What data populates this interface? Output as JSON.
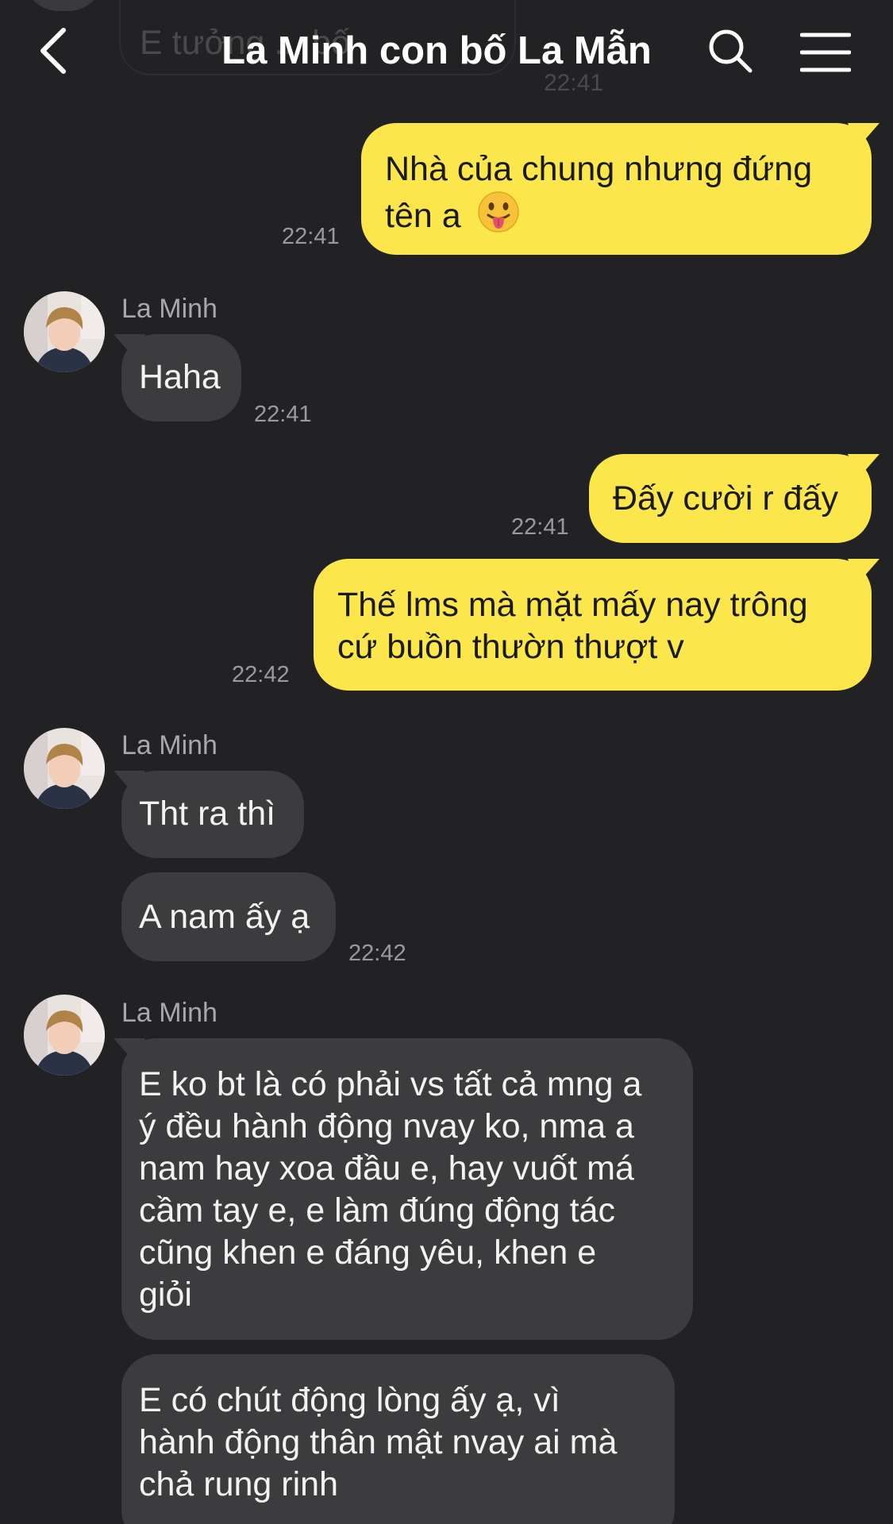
{
  "header": {
    "title": "La Minh con bố La Mẫn",
    "back_icon": "chevron-left-icon",
    "search_icon": "search-icon",
    "menu_icon": "hamburger-menu-icon"
  },
  "previous_message": {
    "text": "E tưởng ... bố",
    "time": "22:41"
  },
  "colors": {
    "background": "#222224",
    "outgoing_bubble": "#fbe64c",
    "incoming_bubble": "#3c3c3e"
  },
  "messages": [
    {
      "direction": "out",
      "lines": [
        "Nhà của chung nhưng đứng",
        "tên a"
      ],
      "emoji": "tongue-out-emoji",
      "time": "22:41"
    },
    {
      "direction": "in",
      "sender": "La Minh",
      "lines": [
        "Haha"
      ],
      "time": "22:41"
    },
    {
      "direction": "out",
      "lines": [
        "Đấy cười r đấy"
      ],
      "time": "22:41"
    },
    {
      "direction": "out",
      "lines": [
        "Thế lms mà mặt mấy nay trông",
        "cứ buồn thườn thượt v"
      ],
      "time": "22:42"
    },
    {
      "direction": "in",
      "sender": "La Minh",
      "lines": [
        "Tht ra thì"
      ]
    },
    {
      "direction": "in",
      "lines": [
        "A nam ấy ạ"
      ],
      "time": "22:42"
    },
    {
      "direction": "in",
      "sender": "La Minh",
      "lines": [
        "E ko bt là có phải vs tất cả mng a",
        "ý đều hành động nvay ko, nma a",
        "nam hay xoa đầu e, hay vuốt má",
        "cầm tay e, e làm đúng động tác",
        "cũng khen e đáng yêu, khen e",
        "giỏi"
      ]
    },
    {
      "direction": "in",
      "lines": [
        "E có chút động lòng ấy ạ, vì",
        "hành động thân mật nvay ai mà",
        "chả rung rinh"
      ]
    }
  ]
}
